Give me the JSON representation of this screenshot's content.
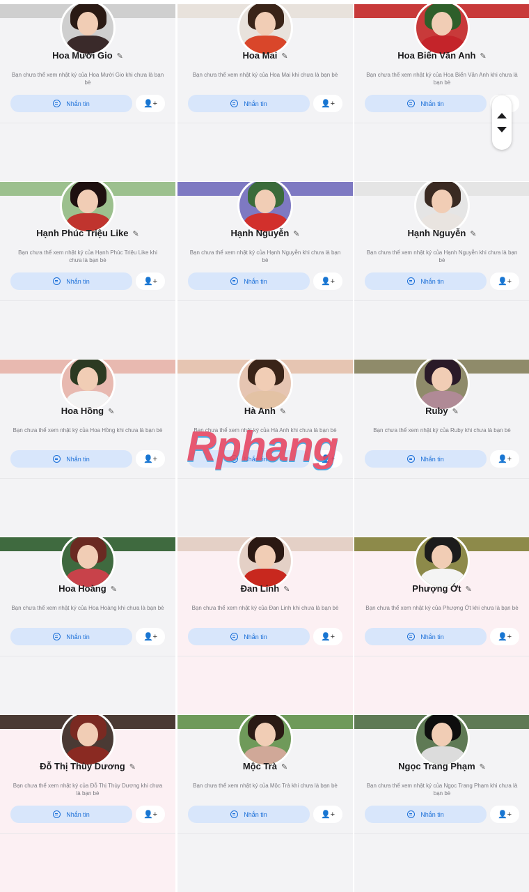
{
  "message_label": "Nhắn tin",
  "cards": [
    {
      "name": "Hoa Mười Gio",
      "desc": "Bạn chưa thể xem nhật ký của Hoa Mười Gio khi chưa là bạn bè",
      "cover": "#cfcfcf",
      "hair": "#2a1a14",
      "body": "#3a2a2a",
      "pink": false
    },
    {
      "name": "Hoa Mai",
      "desc": "Bạn chưa thể xem nhật ký của Hoa Mai khi chưa là bạn bè",
      "cover": "#e8e2dc",
      "hair": "#3a2418",
      "body": "#d9462a",
      "pink": false
    },
    {
      "name": "Hoa Biển Văn Anh",
      "desc": "Bạn chưa thể xem nhật ký của Hoa Biển Văn Anh khi chưa là bạn bè",
      "cover": "#c83a3a",
      "hair": "#2e5f2a",
      "body": "#c4242a",
      "pink": false
    },
    {
      "name": "Hạnh Phúc Triệu Like",
      "desc": "Bạn chưa thể xem nhật ký của Hạnh Phúc Triệu Like khi chưa là bạn bè",
      "cover": "#9cc08e",
      "hair": "#1e1010",
      "body": "#c0342e",
      "pink": false
    },
    {
      "name": "Hạnh Nguyễn",
      "desc": "Bạn chưa thể xem nhật ký của Hạnh Nguyễn khi chưa là bạn bè",
      "cover": "#7e79c2",
      "hair": "#3b6b3a",
      "body": "#d2302c",
      "pink": false
    },
    {
      "name": "Hạnh Nguyễn",
      "desc": "Bạn chưa thể xem nhật ký của Hạnh Nguyễn khi chưa là bạn bè",
      "cover": "#e5e5e5",
      "hair": "#3a2a22",
      "body": "#e9e4e0",
      "pink": false
    },
    {
      "name": "Hoa Hồng",
      "desc": "Bạn chưa thể xem nhật ký của Hoa Hồng khi chưa là bạn bè",
      "cover": "#e8b9b0",
      "hair": "#2c3a22",
      "body": "#f3f3f3",
      "pink": false
    },
    {
      "name": "Hà Anh",
      "desc": "Bạn chưa thể xem nhật ký của Hà Anh khi chưa là bạn bè",
      "cover": "#e6c5b2",
      "hair": "#3a2418",
      "body": "#e3c2a4",
      "pink": false
    },
    {
      "name": "Ruby",
      "desc": "Bạn chưa thể xem nhật ký của Ruby khi chưa là bạn bè",
      "cover": "#8f8b6a",
      "hair": "#2a1a28",
      "body": "#b08a96",
      "pink": false
    },
    {
      "name": "Hoa Hoàng",
      "desc": "Bạn chưa thể xem nhật ký của Hoa Hoàng khi chưa là bạn bè",
      "cover": "#3f6a3f",
      "hair": "#6a2a22",
      "body": "#c8424a",
      "pink": false
    },
    {
      "name": "Đan Linh",
      "desc": "Bạn chưa thể xem nhật ký của Đan Linh khi chưa là bạn bè",
      "cover": "#e4d0c6",
      "hair": "#2a1812",
      "body": "#c8281e",
      "pink": true
    },
    {
      "name": "Phượng Ớt",
      "desc": "Bạn chưa thể xem nhật ký của Phượng Ớt khi chưa là bạn bè",
      "cover": "#8d8a4a",
      "hair": "#1c1c1c",
      "body": "#f4f4f4",
      "pink": true
    },
    {
      "name": "Đỗ Thị Thùy Dương",
      "desc": "Bạn chưa thể xem nhật ký của Đỗ Thị Thùy Dương khi chưa là bạn bè",
      "cover": "#4a3a34",
      "hair": "#7a2a22",
      "body": "#8a2a22",
      "pink": true
    },
    {
      "name": "Mộc Trà",
      "desc": "Bạn chưa thể xem nhật ký của Mộc Trà khi chưa là bạn bè",
      "cover": "#6f9a5a",
      "hair": "#2a1a14",
      "body": "#d0a898",
      "pink": false
    },
    {
      "name": "Ngọc Trang Phạm",
      "desc": "Bạn chưa thể xem nhật ký của Ngọc Trang Phạm khi chưa là bạn bè",
      "cover": "#5f7a55",
      "hair": "#0e0e0e",
      "body": "#dcdcdc",
      "pink": false
    }
  ],
  "watermark": "Rphang"
}
